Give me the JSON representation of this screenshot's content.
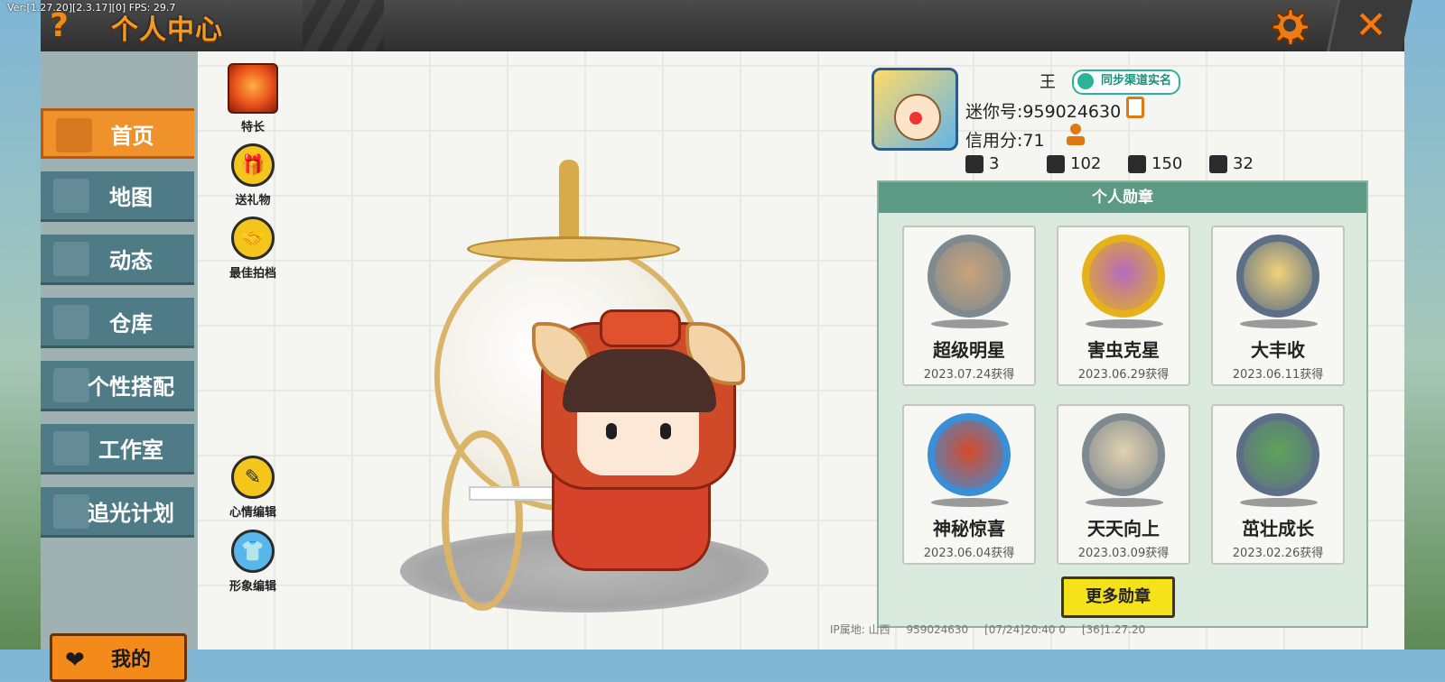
{
  "debug": "Ver:[1.27.20][2.3.17][0]  FPS: 29.7",
  "header": {
    "help": "?",
    "title": "个人中心",
    "close": "✕"
  },
  "sidebar": {
    "items": [
      {
        "label": "首页"
      },
      {
        "label": "地图"
      },
      {
        "label": "动态"
      },
      {
        "label": "仓库"
      },
      {
        "label": "个性搭配"
      },
      {
        "label": "工作室"
      },
      {
        "label": "追光计划"
      }
    ],
    "mine": "我的"
  },
  "skills": {
    "special": "特长",
    "gift": "送礼物",
    "partner": "最佳拍档",
    "mood": "心情编辑",
    "image": "形象编辑"
  },
  "profile": {
    "name": "王",
    "sync": "同步渠道实名",
    "mini_id": "迷你号:959024630",
    "credit": "信用分:71",
    "stats": [
      {
        "icon": "plus-icon",
        "value": "3"
      },
      {
        "icon": "trophy-icon",
        "value": "102"
      },
      {
        "icon": "fire-icon",
        "value": "150"
      },
      {
        "icon": "heart-icon",
        "value": "32"
      }
    ]
  },
  "medals": {
    "title": "个人勋章",
    "items": [
      {
        "name": "超级明星",
        "date": "2023.07.24获得",
        "ring": "#7e8a90",
        "fill": "#c9a37a"
      },
      {
        "name": "害虫克星",
        "date": "2023.06.29获得",
        "ring": "#e6b21c",
        "fill": "#b46ac0"
      },
      {
        "name": "大丰收",
        "date": "2023.06.11获得",
        "ring": "#5d6f86",
        "fill": "#f0d27a"
      },
      {
        "name": "神秘惊喜",
        "date": "2023.06.04获得",
        "ring": "#3b8fd6",
        "fill": "#d8492a"
      },
      {
        "name": "天天向上",
        "date": "2023.03.09获得",
        "ring": "#7e8a90",
        "fill": "#e3d1b0"
      },
      {
        "name": "茁壮成长",
        "date": "2023.02.26获得",
        "ring": "#5d6f86",
        "fill": "#5fa35a"
      }
    ],
    "more": "更多勋章"
  },
  "footer": {
    "ip": "IP属地: 山西",
    "id": "959024630",
    "time": "[07/24]20:40 0",
    "ver": "[36]1.27.20"
  },
  "colors": {
    "accent": "#f0922c",
    "nav": "#4f7b86",
    "medal_head": "#5c9a86",
    "more_btn": "#f6e21a"
  }
}
